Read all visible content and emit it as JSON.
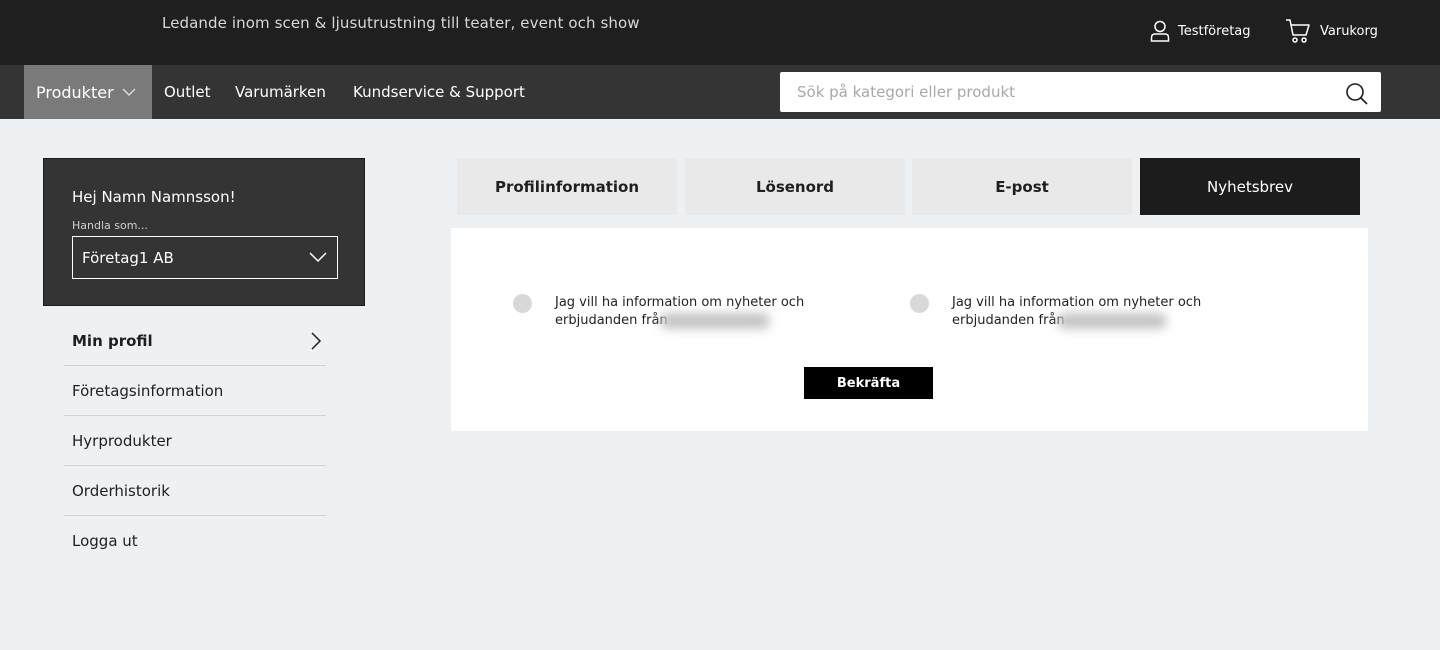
{
  "header": {
    "tagline": "Ledande inom scen & ljusutrustning till teater, event och show",
    "account_label": "Testföretag",
    "cart_label": "Varukorg"
  },
  "nav": {
    "products_label": "Produkter",
    "links": [
      "Outlet",
      "Varumärken",
      "Kundservice & Support"
    ],
    "search_placeholder": "Sök på kategori eller produkt"
  },
  "sidebar": {
    "greeting": "Hej Namn Namnsson!",
    "shop_as_label": "Handla som...",
    "company": "Företag1 AB",
    "items": [
      {
        "label": "Min profil"
      },
      {
        "label": "Företagsinformation"
      },
      {
        "label": "Hyrprodukter"
      },
      {
        "label": "Orderhistorik"
      },
      {
        "label": "Logga ut"
      }
    ]
  },
  "tabs": [
    "Profilinformation",
    "Lösenord",
    "E-post",
    "Nyhetsbrev"
  ],
  "newsletter": {
    "options": [
      {
        "text": "Jag vill ha information om nyheter och erbjudanden från"
      },
      {
        "text": "Jag vill ha information om nyheter och erbjudanden från"
      }
    ],
    "confirm_label": "Bekräfta"
  },
  "colors": {
    "topbar": "#1f1f1f",
    "navbar": "#343434",
    "active_nav": "#7a7a7a",
    "page_bg": "#edf1f4",
    "active_tab": "#1c1c1c"
  }
}
